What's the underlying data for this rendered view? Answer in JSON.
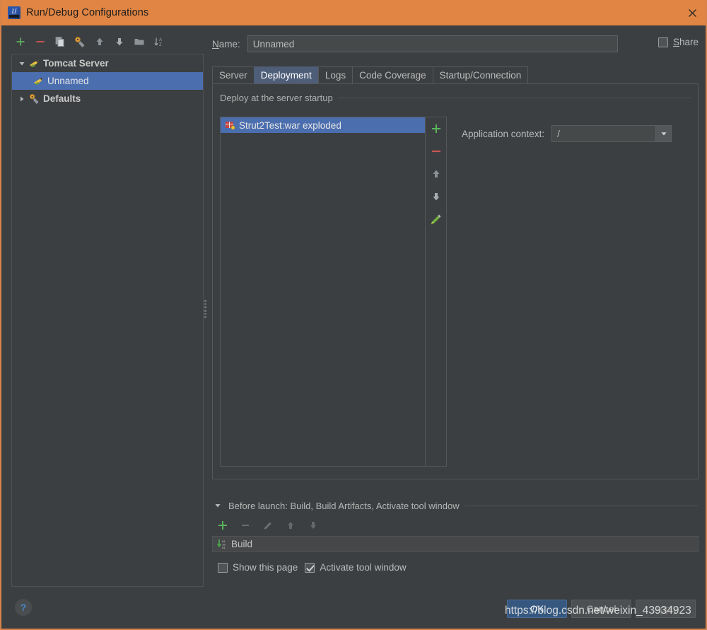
{
  "window": {
    "title": "Run/Debug Configurations",
    "app_icon": "intellij-idea-logo",
    "close_icon": "close-icon",
    "title_bar_color": "#e08543"
  },
  "left_panel": {
    "toolbar": [
      {
        "name": "add-configuration-button",
        "icon": "plus-icon",
        "tooltip": "Add New Configuration"
      },
      {
        "name": "remove-configuration-button",
        "icon": "minus-icon",
        "tooltip": "Remove Configuration"
      },
      {
        "name": "copy-configuration-button",
        "icon": "copy-icon",
        "tooltip": "Copy Configuration"
      },
      {
        "name": "edit-defaults-button",
        "icon": "wrench-icon",
        "tooltip": "Edit defaults"
      },
      {
        "name": "move-up-button",
        "icon": "arrow-up-icon",
        "tooltip": "Move Up"
      },
      {
        "name": "move-down-button",
        "icon": "arrow-down-icon",
        "tooltip": "Move Down"
      },
      {
        "name": "create-folder-button",
        "icon": "folder-icon",
        "tooltip": "Create New Folder"
      },
      {
        "name": "sort-button",
        "icon": "sort-az-icon",
        "tooltip": "Sort Configurations"
      }
    ],
    "tree": [
      {
        "label": "Tomcat Server",
        "icon": "tomcat-icon",
        "level": 0,
        "expanded": true,
        "selected": false,
        "bold": true
      },
      {
        "label": "Unnamed",
        "icon": "tomcat-icon",
        "level": 1,
        "expanded": null,
        "selected": true,
        "bold": false
      },
      {
        "label": "Defaults",
        "icon": "wrench-icon",
        "level": 0,
        "expanded": false,
        "selected": false,
        "bold": true
      }
    ]
  },
  "name_row": {
    "label": "Name:",
    "label_mnemonic": "N",
    "value": "Unnamed",
    "placeholder": "",
    "share_label": "Share",
    "share_mnemonic": "S",
    "share_checked": false
  },
  "tabs": [
    {
      "label": "Server",
      "active": false
    },
    {
      "label": "Deployment",
      "active": true
    },
    {
      "label": "Logs",
      "active": false
    },
    {
      "label": "Code Coverage",
      "active": false
    },
    {
      "label": "Startup/Connection",
      "active": false
    }
  ],
  "deployment": {
    "section_title": "Deploy at the server startup",
    "artifacts": [
      {
        "label": "Strut2Test:war exploded",
        "icon": "artifact-war-icon",
        "selected": true
      }
    ],
    "side_toolbar": [
      {
        "name": "add-artifact-button",
        "icon": "plus-icon"
      },
      {
        "name": "remove-artifact-button",
        "icon": "minus-icon"
      },
      {
        "name": "move-artifact-up-button",
        "icon": "arrow-up-icon"
      },
      {
        "name": "move-artifact-down-button",
        "icon": "arrow-down-icon"
      },
      {
        "name": "edit-artifact-button",
        "icon": "pencil-icon"
      }
    ],
    "application_context_label": "Application context:",
    "application_context_value": "/"
  },
  "before_launch": {
    "title": "Before launch: Build, Build Artifacts, Activate tool window",
    "title_mnemonic": "B",
    "toolbar": [
      {
        "name": "add-task-button",
        "icon": "plus-icon",
        "enabled": true
      },
      {
        "name": "remove-task-button",
        "icon": "minus-icon",
        "enabled": false
      },
      {
        "name": "edit-task-button",
        "icon": "pencil-icon",
        "enabled": false
      },
      {
        "name": "task-move-up-button",
        "icon": "arrow-up-icon",
        "enabled": false
      },
      {
        "name": "task-move-down-button",
        "icon": "arrow-down-icon",
        "enabled": false
      }
    ],
    "tasks": [
      {
        "label": "Build",
        "icon": "build-icon"
      }
    ],
    "checkboxes": [
      {
        "label": "Show this page",
        "checked": false
      },
      {
        "label": "Activate tool window",
        "checked": true
      }
    ]
  },
  "footer": {
    "help_label": "?",
    "buttons": [
      {
        "label": "OK",
        "style": "primary",
        "enabled": true
      },
      {
        "label": "Cancel",
        "style": "normal",
        "enabled": true
      },
      {
        "label": "Apply",
        "style": "normal",
        "enabled": false
      }
    ]
  },
  "watermark": {
    "text": "https://blog.csdn.net/weixin_43934923"
  },
  "colors": {
    "title_bar": "#e08543",
    "dialog_bg": "#3c3f41",
    "selection_blue": "#4b6eaf",
    "active_tab": "#4e5e78",
    "primary_button": "#365880",
    "accent_green": "#5aa35a",
    "accent_red": "#c75450",
    "text": "#bbbbbb"
  }
}
